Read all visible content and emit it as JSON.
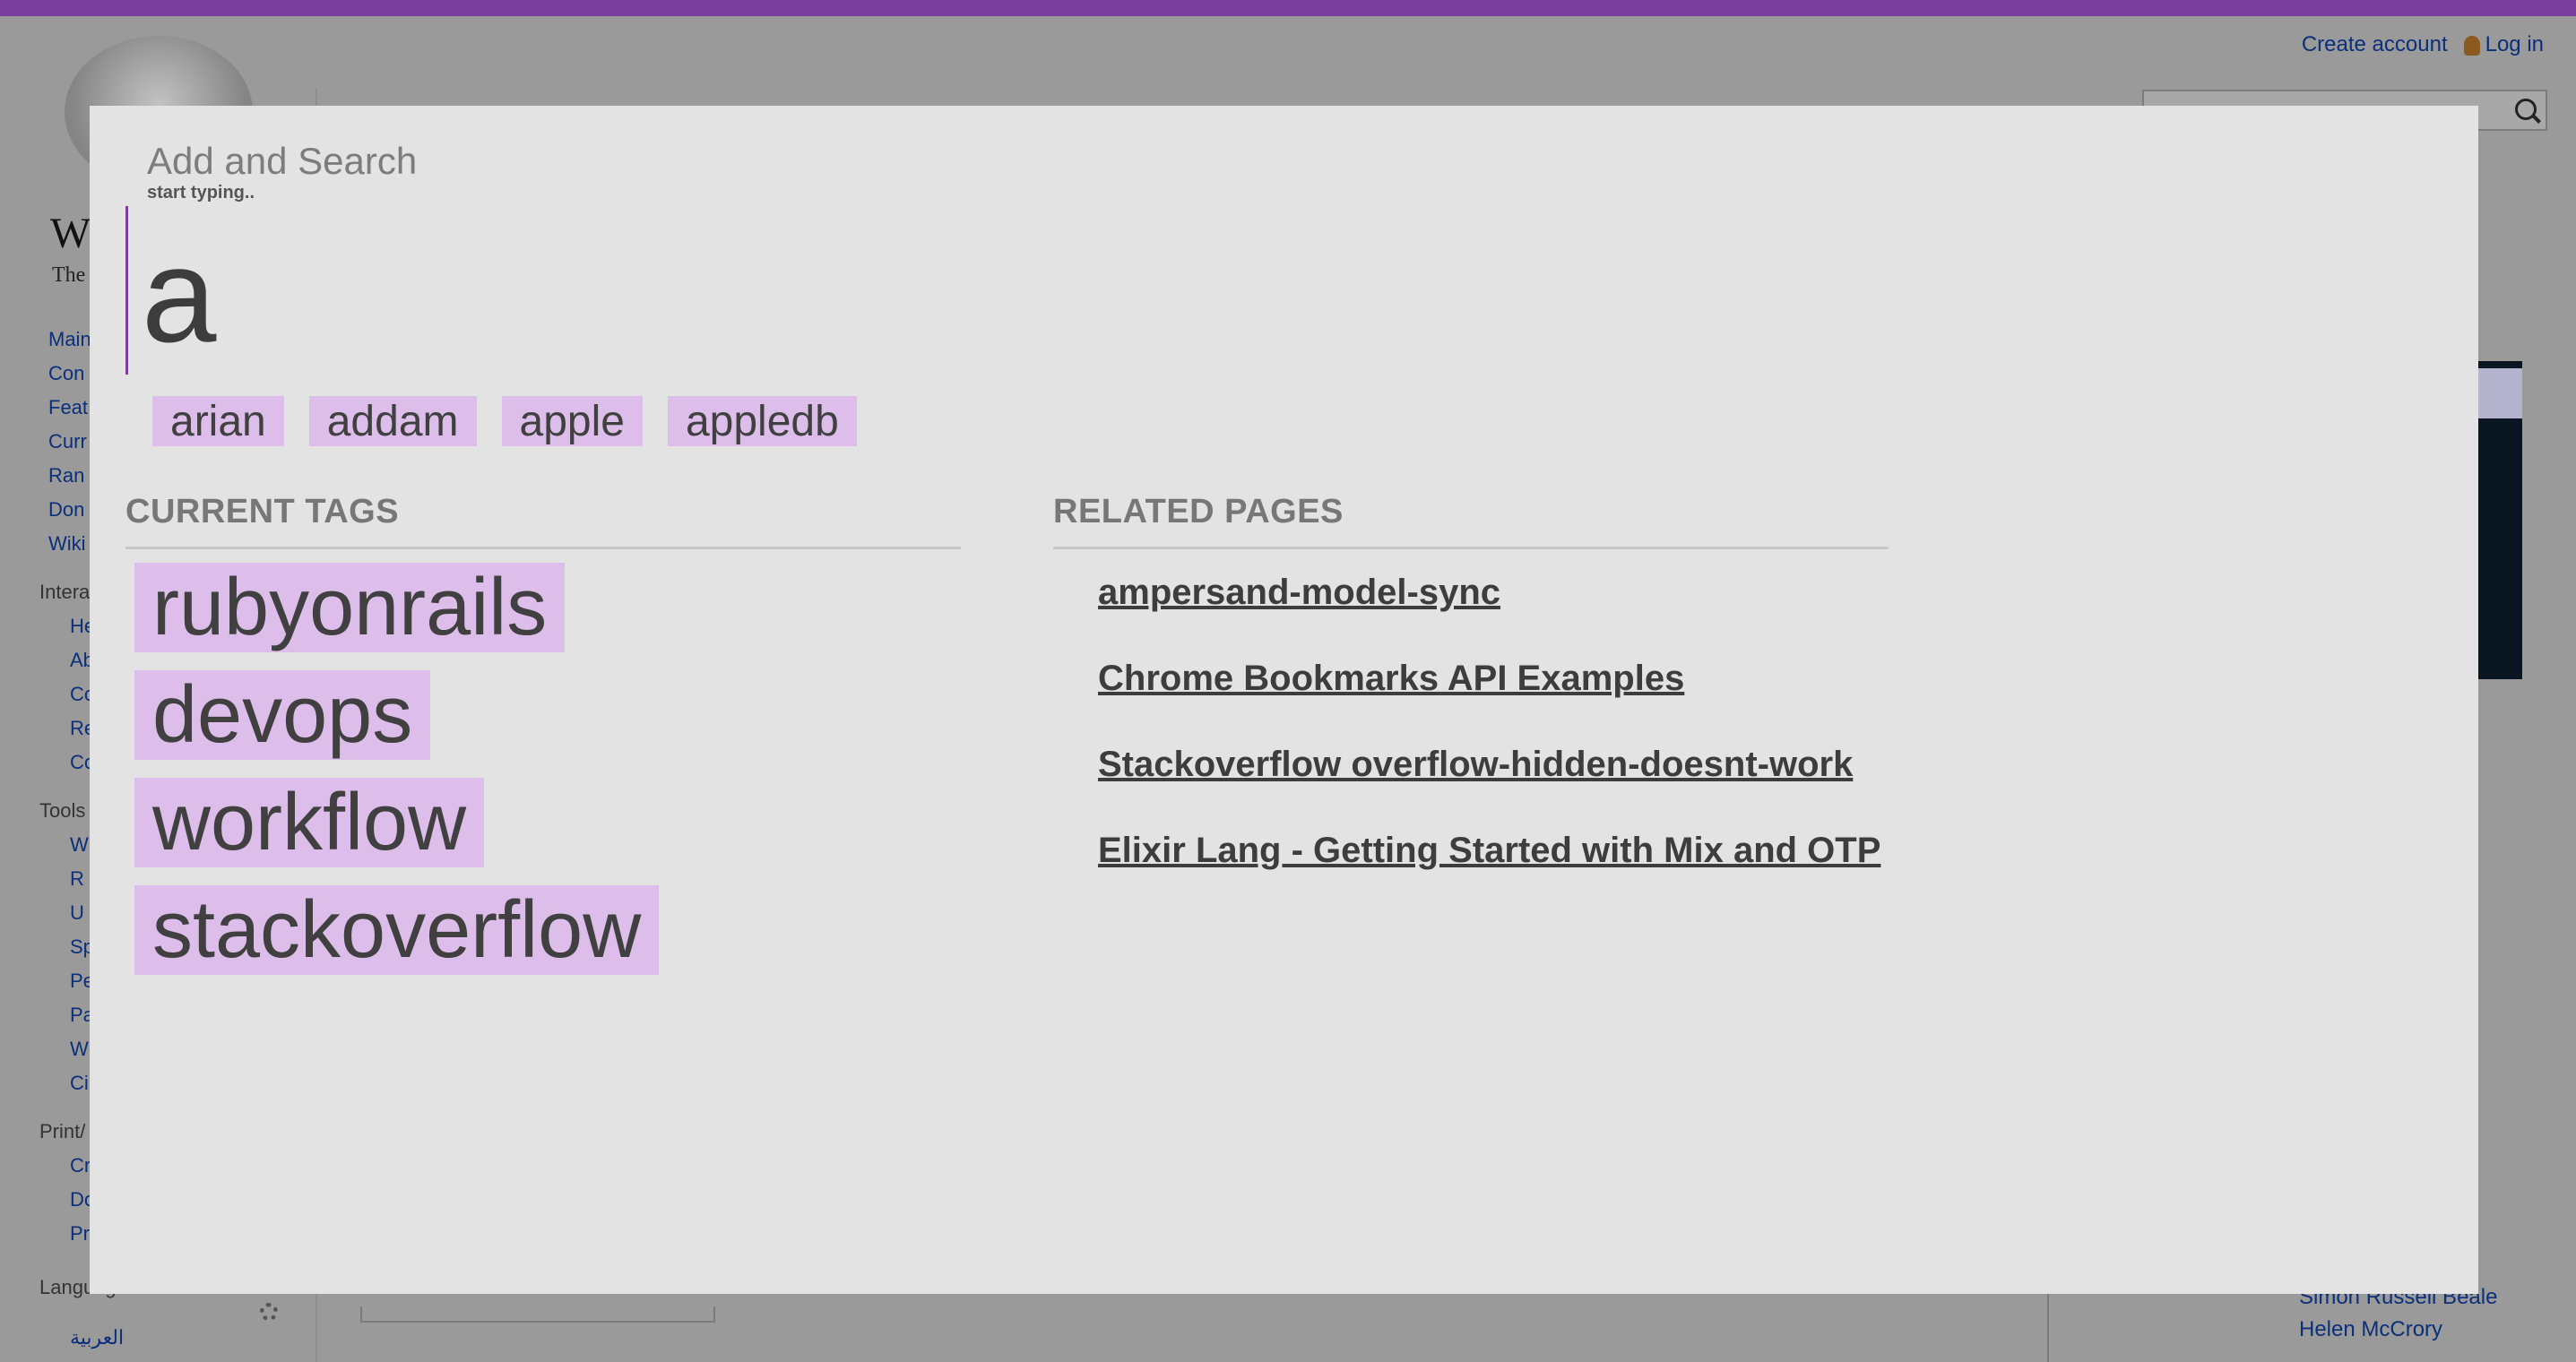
{
  "wiki": {
    "wordmark": "W",
    "tagline": "The",
    "personal": {
      "create_account": "Create account",
      "log_in": "Log in"
    },
    "sidebar_nav": [
      "Main",
      "Con",
      "Feat",
      "Curr",
      "Ran",
      "Don",
      "Wiki"
    ],
    "interaction": {
      "heading": "Intera",
      "items": [
        "He",
        "Ab",
        "Co",
        "Re",
        "Co"
      ]
    },
    "tools": {
      "heading": "Tools",
      "items": [
        "W",
        "R",
        "U",
        "Sp",
        "Pe",
        "Pa",
        "W",
        "Ci"
      ]
    },
    "print": {
      "heading": "Print/",
      "items": [
        "Cr",
        "Do",
        "Pr"
      ]
    },
    "languages": {
      "heading": "Languages",
      "items": [
        "العربية"
      ]
    },
    "cast": [
      "Simon Russell Beale",
      "Helen McCrory"
    ]
  },
  "overlay": {
    "title": "Add and Search",
    "hint": "start typing..",
    "search_value": "a",
    "suggestions": [
      "arian",
      "addam",
      "apple",
      "appledb"
    ],
    "current_tags_heading": "CURRENT TAGS",
    "current_tags": [
      "rubyonrails",
      "devops",
      "workflow",
      "stackoverflow"
    ],
    "related_pages_heading": "RELATED PAGES",
    "related_pages": [
      "ampersand-model-sync",
      "Chrome Bookmarks API Examples",
      "Stackoverflow overflow-hidden-doesnt-work",
      "Elixir Lang - Getting Started with Mix and OTP"
    ]
  },
  "colors": {
    "accent": "#7a3f9d",
    "tag_bg": "#ddbdea",
    "overlay_bg": "#e3e3e3",
    "link": "#0b2f7a"
  }
}
